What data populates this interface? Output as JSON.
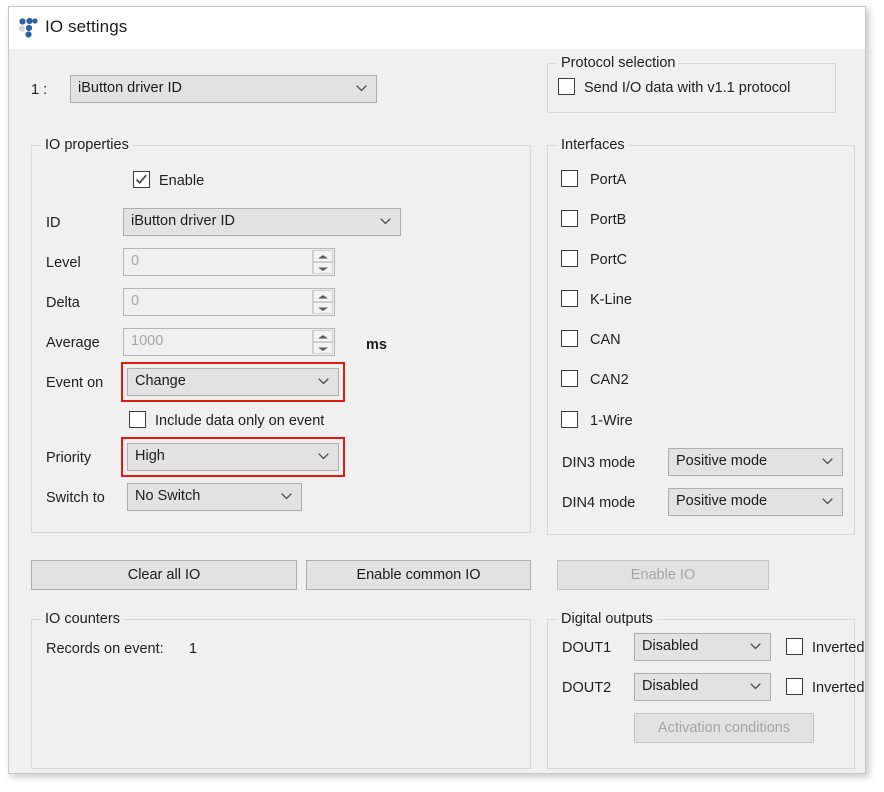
{
  "window": {
    "title": "IO settings",
    "icon": "dots-pattern-icon"
  },
  "top_selector": {
    "index_label": "1  :",
    "value": "iButton driver ID"
  },
  "protocol_selection": {
    "legend": "Protocol selection",
    "checkbox_label": "Send I/O data with v1.1 protocol",
    "checked": false
  },
  "io_properties": {
    "legend": "IO properties",
    "enable": {
      "label": "Enable",
      "checked": true
    },
    "id": {
      "label": "ID",
      "value": "iButton driver ID"
    },
    "level": {
      "label": "Level",
      "value": "0"
    },
    "delta": {
      "label": "Delta",
      "value": "0"
    },
    "average": {
      "label": "Average",
      "value": "1000",
      "unit": "ms"
    },
    "event_on": {
      "label": "Event on",
      "value": "Change",
      "highlighted": true
    },
    "include_data": {
      "label": "Include data only on event",
      "checked": false
    },
    "priority": {
      "label": "Priority",
      "value": "High",
      "highlighted": true
    },
    "switch_to": {
      "label": "Switch to",
      "value": "No Switch"
    }
  },
  "interfaces": {
    "legend": "Interfaces",
    "checkboxes": [
      {
        "label": "PortA",
        "checked": false
      },
      {
        "label": "PortB",
        "checked": false
      },
      {
        "label": "PortC",
        "checked": false
      },
      {
        "label": "K-Line",
        "checked": false
      },
      {
        "label": "CAN",
        "checked": false
      },
      {
        "label": "CAN2",
        "checked": false
      },
      {
        "label": "1-Wire",
        "checked": false
      }
    ],
    "din3": {
      "label": "DIN3 mode",
      "value": "Positive mode"
    },
    "din4": {
      "label": "DIN4 mode",
      "value": "Positive mode"
    }
  },
  "buttons": {
    "clear_all_io": "Clear all IO",
    "enable_common_io": "Enable common IO",
    "enable_io": "Enable IO",
    "enable_io_disabled": true
  },
  "io_counters": {
    "legend": "IO counters",
    "records_on_event_label": "Records on event:",
    "records_on_event_value": "1"
  },
  "digital_outputs": {
    "legend": "Digital outputs",
    "rows": [
      {
        "label": "DOUT1",
        "value": "Disabled",
        "inverted_label": "Inverted",
        "inverted": false
      },
      {
        "label": "DOUT2",
        "value": "Disabled",
        "inverted_label": "Inverted",
        "inverted": false
      }
    ],
    "activation_conditions": "Activation conditions",
    "activation_conditions_disabled": true
  },
  "colors": {
    "highlight": "#e21b10",
    "window_bg": "#f0f0f0",
    "titlebar_bg": "#ffffff",
    "control_bg": "#e2e2e2",
    "accent_icon": "#2d5fa8"
  }
}
